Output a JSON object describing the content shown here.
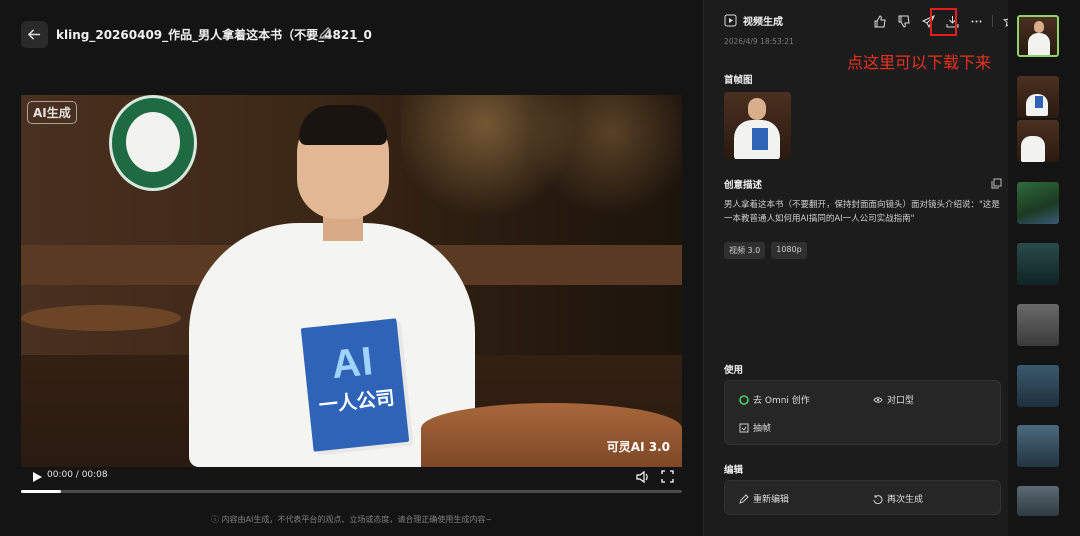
{
  "header": {
    "back_icon": "arrow-left-icon",
    "title": "kling_20260409_作品_男人拿着这本书（不要_4821_0",
    "edit_icon": "pencil-icon"
  },
  "video": {
    "watermark_left": "AI生成",
    "watermark_right": "可灵AI 3.0",
    "book_title": "AI",
    "book_subtitle": "一人公司",
    "time": "00:00 / 00:08",
    "progress_fraction": 0.06,
    "disclaimer": "ⓘ 内容由AI生成，不代表平台的观点、立场或态度，请合理正确使用生成内容~"
  },
  "panel": {
    "type_label": "视频生成",
    "date": "2026/4/9 18:53:21",
    "toolbar_icons": [
      "thumbs-up-icon",
      "thumbs-down-icon",
      "send-icon",
      "download-icon",
      "more-icon",
      "star-icon"
    ],
    "annotation": "点这里可以下载下来",
    "first_frame_label": "首帧图",
    "creative_label": "创意描述",
    "description": "男人拿着这本书（不要翻开，保持封面面向镜头）面对镜头介绍说：\"这是一本教普通人如何用AI搞同的AI一人公司实战指南\"",
    "tags": [
      "视频 3.0",
      "1080p"
    ],
    "use_label": "使用",
    "use_actions": [
      "去 Omni 创作",
      "对口型",
      "抽帧"
    ],
    "edit_label": "编辑",
    "edit_actions": [
      "重新编辑",
      "再次生成"
    ]
  },
  "colors": {
    "accent_red": "#e8321e",
    "selected_border": "#8fd26b",
    "panel_bg": "#1c1c1c"
  }
}
